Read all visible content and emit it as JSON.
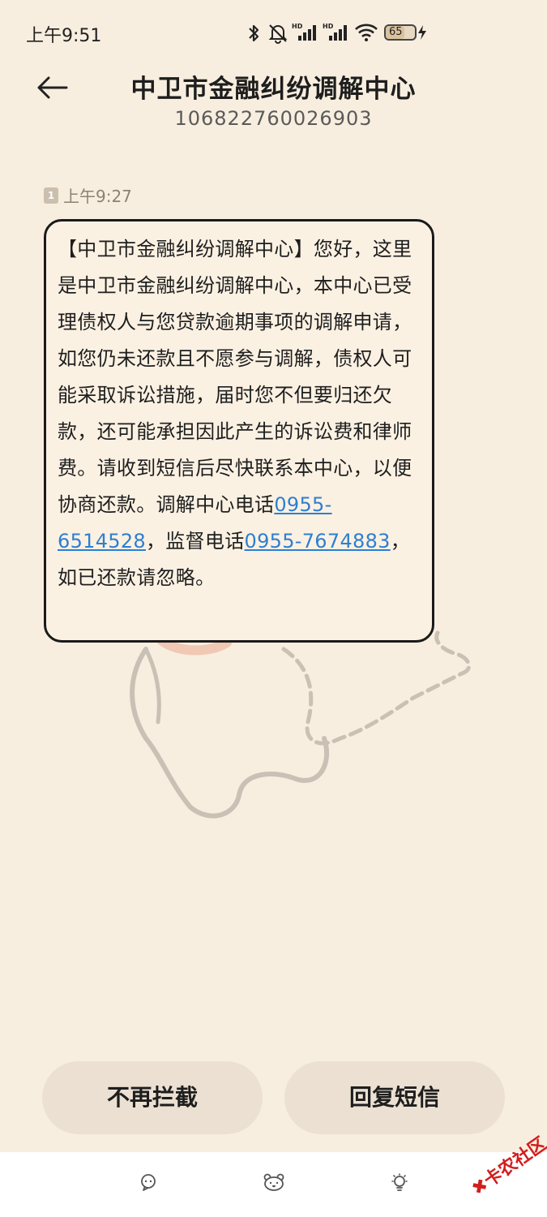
{
  "status_bar": {
    "time": "上午9:51",
    "battery_level": "65",
    "battery_percent": 65,
    "icons": [
      "bluetooth-icon",
      "bell-muted-icon",
      "signal-hd-icon",
      "signal-hd-icon",
      "wifi-icon",
      "battery-icon",
      "charging-icon"
    ]
  },
  "header": {
    "contact_name": "中卫市金融纠纷调解中心",
    "contact_number": "106822760026903"
  },
  "message": {
    "sim_slot": "1",
    "time": "上午9:27",
    "text_part1": "【中卫市金融纠纷调解中心】您好，这里是中卫市金融纠纷调解中心，本中心已受理债权人与您贷款逾期事项的调解申请，如您仍未还款且不愿参与调解，债权人可能采取诉讼措施，届时您不但要归还欠款，还可能承担因此产生的诉讼费和律师费。请收到短信后尽快联系本中心，以便协商还款。调解中心电话",
    "phone1": "0955-6514528",
    "text_part2": "，监督电话",
    "phone2": "0955-7674883",
    "text_part3": "，如已还款请忽略。"
  },
  "actions": {
    "unblock_label": "不再拦截",
    "reply_label": "回复短信"
  },
  "bottom_nav": {
    "icons": [
      "chat-icon",
      "bear-icon",
      "bulb-icon"
    ]
  },
  "watermark": {
    "text": "卡农社区"
  },
  "colors": {
    "background": "#f8eedf",
    "link": "#2d7fd1",
    "button": "#ebe0d2",
    "watermark": "#d21d1d"
  }
}
